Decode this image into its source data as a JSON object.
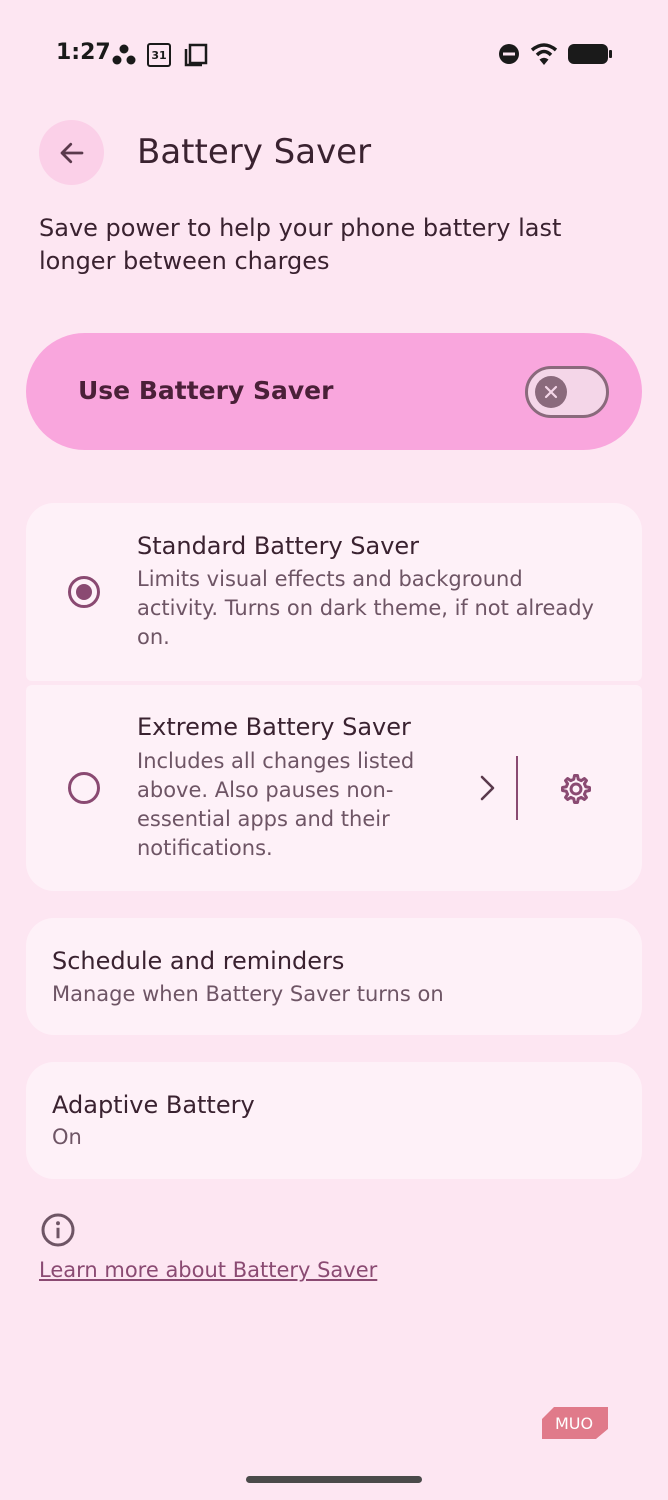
{
  "status_bar": {
    "time": "1:27",
    "calendar_day": "31",
    "left_icons": [
      "dots-icon",
      "calendar-icon",
      "screen-icon"
    ],
    "right_icons": [
      "dnd-icon",
      "wifi-icon",
      "battery-icon"
    ]
  },
  "header": {
    "title": "Battery Saver",
    "back_icon": "arrow-left-icon"
  },
  "description": "Save power to help your phone battery last longer between charges",
  "main_toggle": {
    "label": "Use Battery Saver",
    "state": "off"
  },
  "options": [
    {
      "title": "Standard Battery Saver",
      "description": "Limits visual effects and background activity. Turns on dark theme, if not already on.",
      "selected": true
    },
    {
      "title": "Extreme Battery Saver",
      "description": "Includes all changes listed above. Also pauses non-essential apps and their notifications.",
      "selected": false
    }
  ],
  "schedule": {
    "title": "Schedule and reminders",
    "subtitle": "Manage when Battery Saver turns on"
  },
  "adaptive": {
    "title": "Adaptive Battery",
    "subtitle": "On"
  },
  "footer": {
    "link": "Learn more about Battery Saver",
    "info_icon": "info-icon"
  },
  "watermark": "MUO",
  "colors": {
    "background": "#fde6f2",
    "accent": "#8a4a72",
    "toggle_card": "#f9a6dd",
    "card": "#fef1f8"
  }
}
